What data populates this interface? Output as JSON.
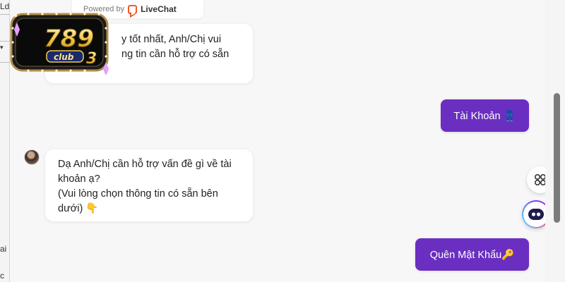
{
  "bg_app": {
    "frag_top": "Ld",
    "frag_mid": "ai",
    "frag_bottom": "c"
  },
  "powered": {
    "prefix": "Powered by",
    "brand": "LiveChat"
  },
  "logo": {
    "text": "789",
    "sub": "club",
    "num": "3",
    "alt": "789 Club logo"
  },
  "messages": {
    "agent1": {
      "line1": "y tốt nhất, Anh/Chị vui",
      "line2": "ng tin cần hỗ trợ có sẵn"
    },
    "user1": {
      "text": "Tài Khoản 👖"
    },
    "agent2": {
      "line1": "Dạ Anh/Chị cần hỗ trợ vấn đề gì về tài",
      "line2": "khoản ạ?",
      "line3": "(Vui lòng chọn thông tin có sẵn bên",
      "line4": "dưới) 👇"
    },
    "user2": {
      "text": "Quên Mật Khẩu🔑"
    }
  },
  "icons": {
    "apps": "apps-grid-icon",
    "chat": "chat-widget-icon",
    "lc": "livechat-logo-icon"
  },
  "colors": {
    "accent": "#6a2fc0",
    "livechat": "#f0582f",
    "chat_bg": "#f7f7f8"
  }
}
